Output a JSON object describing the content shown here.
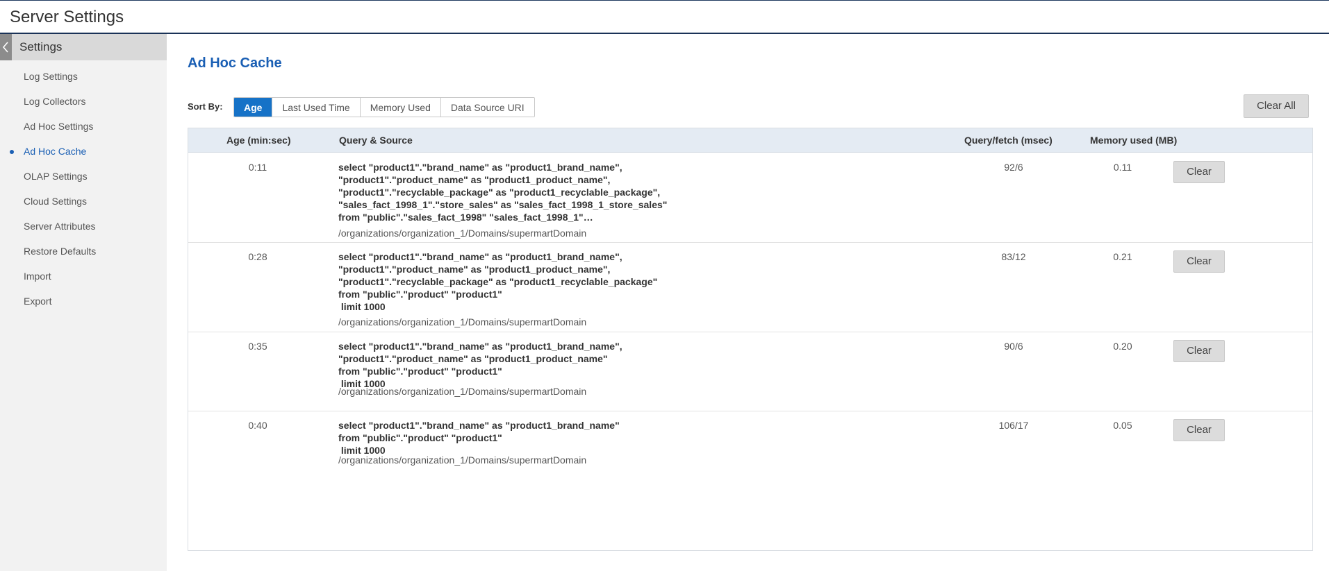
{
  "app": {
    "title": "Server Settings"
  },
  "sidebar": {
    "title": "Settings",
    "items": [
      {
        "label": "Log Settings",
        "active": false
      },
      {
        "label": "Log Collectors",
        "active": false
      },
      {
        "label": "Ad Hoc Settings",
        "active": false
      },
      {
        "label": "Ad Hoc Cache",
        "active": true
      },
      {
        "label": "OLAP Settings",
        "active": false
      },
      {
        "label": "Cloud Settings",
        "active": false
      },
      {
        "label": "Server Attributes",
        "active": false
      },
      {
        "label": "Restore Defaults",
        "active": false
      },
      {
        "label": "Import",
        "active": false
      },
      {
        "label": "Export",
        "active": false
      }
    ]
  },
  "main": {
    "title": "Ad Hoc Cache",
    "sort": {
      "label": "Sort By:",
      "options": [
        "Age",
        "Last Used Time",
        "Memory Used",
        "Data Source URI"
      ],
      "selected": "Age"
    },
    "clear_all_label": "Clear All",
    "table": {
      "headers": {
        "age": "Age (min:sec)",
        "query": "Query & Source",
        "fetch": "Query/fetch (msec)",
        "memory": "Memory used (MB)"
      },
      "clear_label": "Clear",
      "rows": [
        {
          "age": "0:11",
          "query": [
            "select \"product1\".\"brand_name\" as \"product1_brand_name\",",
            "\"product1\".\"product_name\" as \"product1_product_name\",",
            "\"product1\".\"recyclable_package\" as \"product1_recyclable_package\",",
            "\"sales_fact_1998_1\".\"store_sales\" as \"sales_fact_1998_1_store_sales\"",
            "from \"public\".\"sales_fact_1998\" \"sales_fact_1998_1\"…"
          ],
          "source": "/organizations/organization_1/Domains/supermartDomain",
          "fetch": "92/6",
          "memory": "0.11"
        },
        {
          "age": "0:28",
          "query": [
            "select \"product1\".\"brand_name\" as \"product1_brand_name\",",
            "\"product1\".\"product_name\" as \"product1_product_name\",",
            "\"product1\".\"recyclable_package\" as \"product1_recyclable_package\"",
            "from \"public\".\"product\" \"product1\"",
            " limit 1000"
          ],
          "source": "/organizations/organization_1/Domains/supermartDomain",
          "fetch": "83/12",
          "memory": "0.21"
        },
        {
          "age": "0:35",
          "query": [
            "select \"product1\".\"brand_name\" as \"product1_brand_name\",",
            "\"product1\".\"product_name\" as \"product1_product_name\"",
            "from \"public\".\"product\" \"product1\"",
            " limit 1000"
          ],
          "source": "/organizations/organization_1/Domains/supermartDomain",
          "fetch": "90/6",
          "memory": "0.20"
        },
        {
          "age": "0:40",
          "query": [
            "select \"product1\".\"brand_name\" as \"product1_brand_name\"",
            "from \"public\".\"product\" \"product1\"",
            " limit 1000"
          ],
          "source": "/organizations/organization_1/Domains/supermartDomain",
          "fetch": "106/17",
          "memory": "0.05"
        }
      ]
    }
  }
}
